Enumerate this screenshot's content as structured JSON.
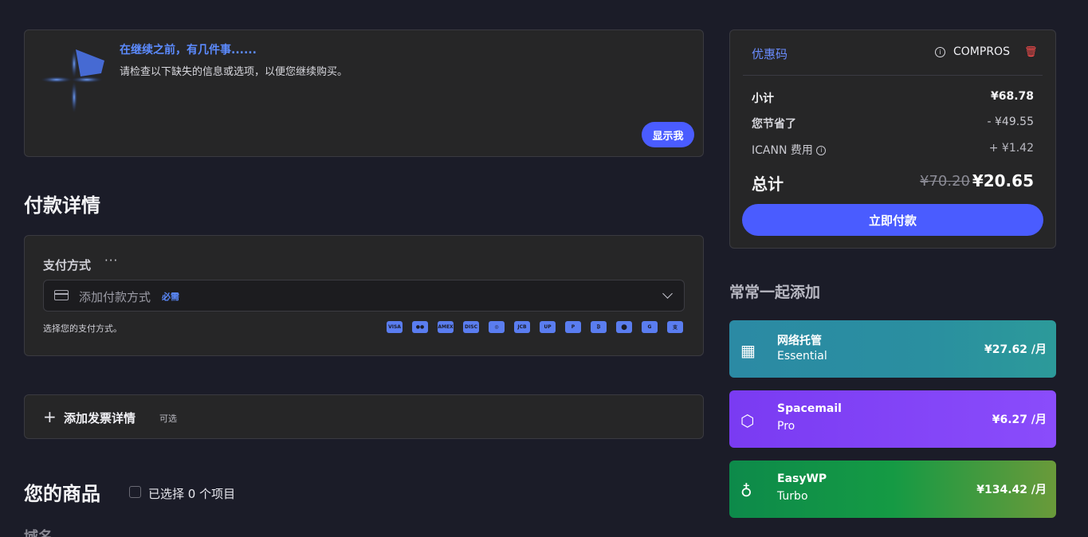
{
  "notice": {
    "title": "在继续之前，有几件事......",
    "description": "请检查以下缺失的信息或选项，以便您继续购买。",
    "show_button": "显示我"
  },
  "payment_section": {
    "heading": "付款详情",
    "method_label": "支付方式",
    "more": "···",
    "select_placeholder": "添加付款方式",
    "required_badge": "必需",
    "hint": "选择您的支付方式。",
    "methods": [
      {
        "icon": "visa-icon",
        "label": "VISA"
      },
      {
        "icon": "mastercard-icon",
        "label": "●●"
      },
      {
        "icon": "amex-icon",
        "label": "AMEX"
      },
      {
        "icon": "discover-icon",
        "label": "DISC"
      },
      {
        "icon": "diners-icon",
        "label": "◎"
      },
      {
        "icon": "jcb-icon",
        "label": "JCB"
      },
      {
        "icon": "unionpay-icon",
        "label": "UP"
      },
      {
        "icon": "paypal-icon",
        "label": "P"
      },
      {
        "icon": "bitcoin-icon",
        "label": "₿"
      },
      {
        "icon": "apple-pay-icon",
        "label": ""
      },
      {
        "icon": "google-pay-icon",
        "label": "G"
      },
      {
        "icon": "alipay-icon",
        "label": "支"
      }
    ]
  },
  "invoice": {
    "label": "添加发票详情",
    "optional": "可选"
  },
  "items": {
    "heading": "您的商品",
    "selected_text": "已选择 0 个项目",
    "domain_label": "域名"
  },
  "summary": {
    "promo_label": "优惠码",
    "promo_code": "COMPROS",
    "subtotal_label": "小计",
    "subtotal_value": "¥68.78",
    "savings_label": "您节省了",
    "savings_value": "- ¥49.55",
    "icann_label": "ICANN 费用",
    "icann_value": "+ ¥1.42",
    "total_label": "总计",
    "total_old": "¥70.20",
    "total_new": "¥20.65",
    "pay_button": "立即付款"
  },
  "addons": {
    "heading": "常常一起添加",
    "items": [
      {
        "name": "网络托管",
        "tier": "Essential",
        "price": "¥27.62 /月",
        "icon": "hosting-icon"
      },
      {
        "name": "Spacemail",
        "tier": "Pro",
        "price": "¥6.27 /月",
        "icon": "spacemail-icon"
      },
      {
        "name": "EasyWP",
        "tier": "Turbo",
        "price": "¥134.42 /月",
        "icon": "easywp-icon"
      }
    ]
  }
}
